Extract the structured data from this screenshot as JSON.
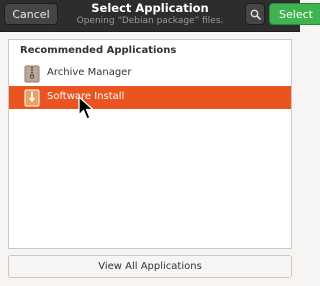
{
  "header": {
    "cancel_label": "Cancel",
    "title": "Select Application",
    "subtitle": "Opening “Debian package” files.",
    "select_label": "Select"
  },
  "list": {
    "section_heading": "Recommended Applications",
    "apps": [
      {
        "label": "Archive Manager",
        "icon": "archive-manager-icon",
        "selected": false
      },
      {
        "label": "Software Install",
        "icon": "software-install-icon",
        "selected": true
      }
    ]
  },
  "footer": {
    "view_all_label": "View All Applications"
  },
  "colors": {
    "headerbar": "#2d2d2d",
    "select_button": "#3eb34f",
    "selection": "#e95420"
  }
}
